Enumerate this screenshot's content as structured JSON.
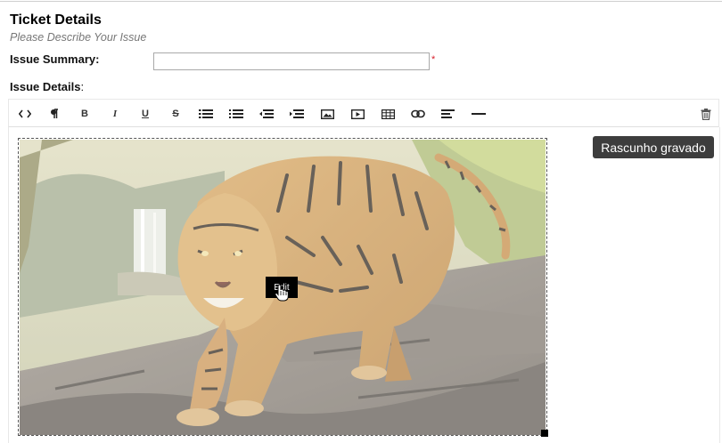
{
  "section": {
    "title": "Ticket Details",
    "subtitle": "Please Describe Your Issue"
  },
  "form": {
    "summary_label": "Issue Summary:",
    "summary_value": "",
    "required_marker": "*",
    "details_label": "Issue Details",
    "details_colon": ":"
  },
  "toolbar": {
    "items": [
      {
        "name": "code-view-icon",
        "glyph": "<>"
      },
      {
        "name": "paragraph-icon",
        "glyph": "¶"
      },
      {
        "name": "bold-icon",
        "glyph": "B"
      },
      {
        "name": "italic-icon",
        "glyph": "I"
      },
      {
        "name": "underline-icon",
        "glyph": "U"
      },
      {
        "name": "strikethrough-icon",
        "glyph": "S"
      },
      {
        "name": "unordered-list-icon",
        "glyph": ""
      },
      {
        "name": "ordered-list-icon",
        "glyph": ""
      },
      {
        "name": "outdent-icon",
        "glyph": ""
      },
      {
        "name": "indent-icon",
        "glyph": ""
      },
      {
        "name": "insert-image-icon",
        "glyph": ""
      },
      {
        "name": "insert-video-icon",
        "glyph": ""
      },
      {
        "name": "insert-table-icon",
        "glyph": ""
      },
      {
        "name": "insert-link-icon",
        "glyph": ""
      },
      {
        "name": "align-icon",
        "glyph": ""
      },
      {
        "name": "horizontal-rule-icon",
        "glyph": ""
      }
    ],
    "trash": "trash-icon"
  },
  "editor": {
    "image_edit_label": "Edit"
  },
  "toast": {
    "text": "Rascunho gravado"
  }
}
